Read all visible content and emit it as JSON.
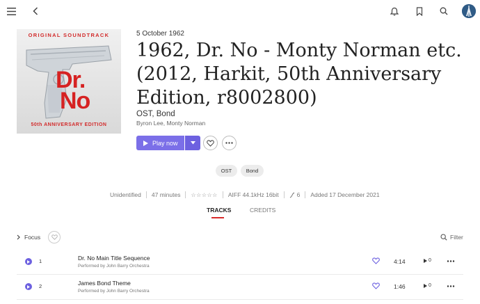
{
  "header": {
    "icons": [
      "menu-icon",
      "back-icon",
      "bell-icon",
      "bookmark-icon",
      "search-icon",
      "avatar"
    ]
  },
  "album": {
    "cover": {
      "top_text": "ORIGINAL SOUNDTRACK",
      "title_line1": "Dr.",
      "title_line2": "No",
      "bottom_text": "50th ANNIVERSARY EDITION"
    },
    "release_date": "5 October 1962",
    "title": "1962, Dr. No - Monty Norman etc. (2012, Harkit, 50th Anniversary Edition, r8002800)",
    "genre": "OST, Bond",
    "artists": "Byron Lee, Monty Norman"
  },
  "actions": {
    "play_label": "Play now"
  },
  "tags": [
    "OST",
    "Bond"
  ],
  "meta": {
    "status": "Unidentified",
    "duration": "47 minutes",
    "rating": "☆☆☆☆☆",
    "format": "AIFF 44.1kHz 16bit",
    "count": "6",
    "added": "Added 17 December 2021"
  },
  "tabs": {
    "tracks": "TRACKS",
    "credits": "CREDITS"
  },
  "focus": {
    "label": "Focus"
  },
  "filter": {
    "label": "Filter"
  },
  "colors": {
    "accent": "#7b6fe8",
    "tab_underline": "#d82a2a"
  },
  "tracks": [
    {
      "number": "1",
      "title": "Dr. No Main Title Sequence",
      "performer": "Performed by John Barry Orchestra",
      "duration": "4:14",
      "plays": "0"
    },
    {
      "number": "2",
      "title": "James Bond Theme",
      "performer": "Performed by John Barry Orchestra",
      "duration": "1:46",
      "plays": "0"
    }
  ]
}
